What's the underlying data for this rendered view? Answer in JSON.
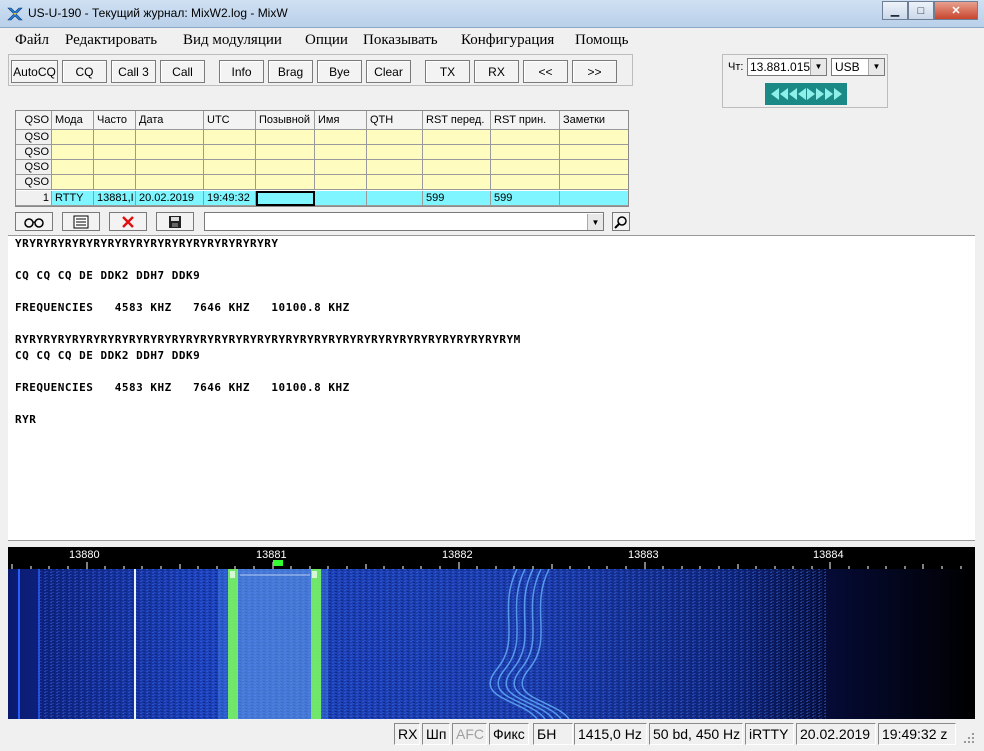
{
  "window": {
    "title": "US-U-190 - Текущий журнал: MixW2.log - MixW",
    "minimize": "▁",
    "maximize": "□",
    "close": "✕"
  },
  "menu": [
    "Файл",
    "Редактировать",
    "Вид модуляции",
    "Опции",
    "Показывать",
    "Конфигурация",
    "Помощь"
  ],
  "macros": [
    "AutoCQ",
    "CQ",
    "Call 3",
    "Call",
    "Info",
    "Brag",
    "Bye",
    "Clear",
    "TX",
    "RX",
    "<<",
    ">>"
  ],
  "freq_panel": {
    "label": "Чт:",
    "frequency": "13.881.015",
    "mode": "USB",
    "tune_icon": "tune-arrows-icon"
  },
  "log": {
    "columns": [
      "QSO",
      "Мода",
      "Часто",
      "Дата",
      "UTC",
      "Позывной",
      "Имя",
      "QTH",
      "RST перед.",
      "RST прин.",
      "Заметки"
    ],
    "empty_rows": [
      "QSO",
      "QSO",
      "QSO",
      "QSO"
    ],
    "active_row": [
      "1",
      "RTTY",
      "13881,I",
      "20.02.2019",
      "19:49:32",
      "",
      "",
      "",
      "599",
      "599",
      ""
    ]
  },
  "log_tools": {
    "icons": [
      "glasses-icon",
      "form-icon",
      "delete-icon",
      "save-icon"
    ],
    "notes_value": "",
    "search_icon": "magnifier-icon"
  },
  "rx_text": [
    "YRYRYRYRYRYRYRYRYRYRYRYRYRYRYRYRYRYRY",
    "",
    "CQ CQ CQ DE DDK2 DDH7 DDK9",
    "",
    "FREQUENCIES   4583 KHZ   7646 KHZ   10100.8 KHZ",
    "",
    "RYRYRYRYRYRYRYRYRYRYRYRYRYRYRYRYRYRYRYRYRYRYRYRYRYRYRYRYRYRYRYRYRYRYRYM",
    "CQ CQ CQ DE DDK2 DDH7 DDK9",
    "",
    "FREQUENCIES   4583 KHZ   7646 KHZ   10100.8 KHZ",
    "",
    "RYR"
  ],
  "waterfall": {
    "scale_labels": [
      "13880",
      "13881",
      "13882",
      "13883",
      "13884"
    ],
    "colors": {
      "background": "#000000",
      "signal": "#1a44c8",
      "marker": "#33ff33"
    }
  },
  "status": {
    "rx": "RX",
    "shp": "Шп",
    "afc": "AFC",
    "fix": "Фикс",
    "bn": "БН",
    "offset": "1415,0 Hz",
    "bandwidth": "50 bd, 450 Hz",
    "mode": "iRTTY",
    "date": "20.02.2019",
    "time": "19:49:32 z"
  }
}
